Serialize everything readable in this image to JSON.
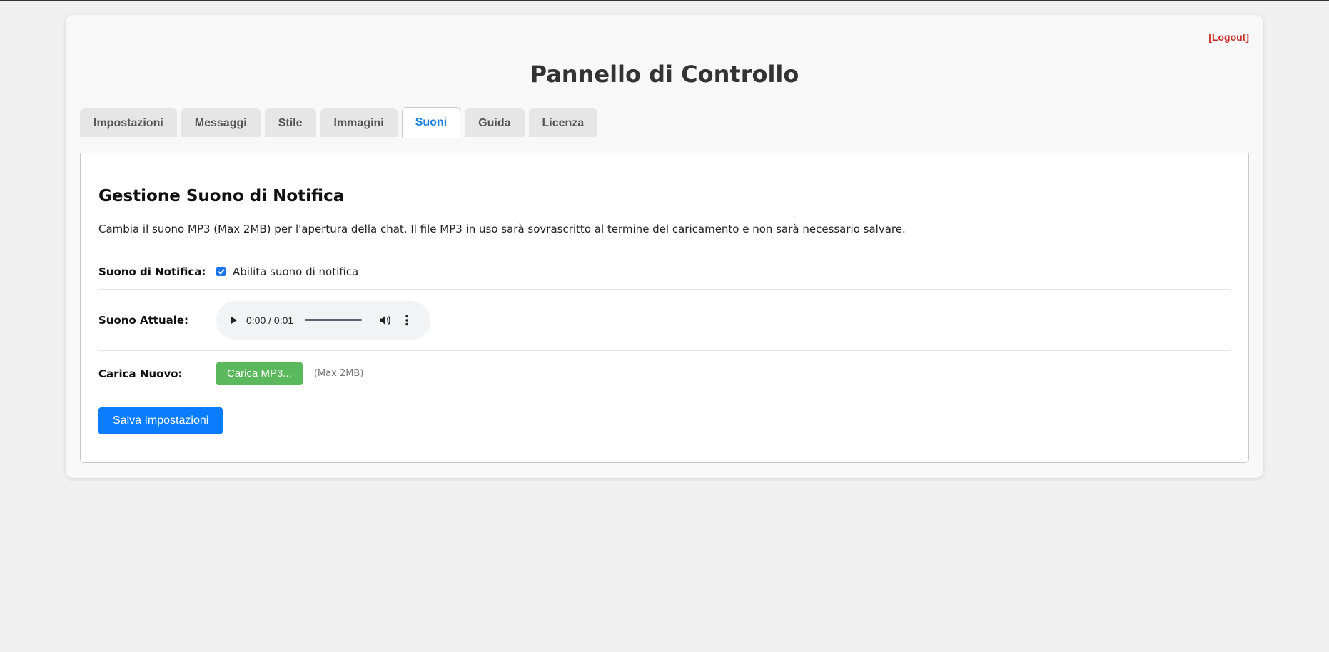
{
  "header": {
    "logout_label": "[Logout]",
    "title": "Pannello di Controllo"
  },
  "tabs": [
    {
      "label": "Impostazioni",
      "active": false
    },
    {
      "label": "Messaggi",
      "active": false
    },
    {
      "label": "Stile",
      "active": false
    },
    {
      "label": "Immagini",
      "active": false
    },
    {
      "label": "Suoni",
      "active": true
    },
    {
      "label": "Guida",
      "active": false
    },
    {
      "label": "Licenza",
      "active": false
    }
  ],
  "sound": {
    "section_title": "Gestione Suono di Notifica",
    "description": "Cambia il suono MP3 (Max 2MB) per l'apertura della chat. Il file MP3 in uso sarà sovrascritto al termine del caricamento e non sarà necessario salvare.",
    "notification": {
      "label": "Suono di Notifica:",
      "checkbox_label": "Abilita suono di notifica",
      "checked": true
    },
    "current": {
      "label": "Suono Attuale:",
      "time_display": "0:00 / 0:01"
    },
    "upload": {
      "label": "Carica Nuovo:",
      "button_label": "Carica MP3...",
      "hint": "(Max 2MB)"
    },
    "save_label": "Salva Impostazioni"
  },
  "icons": {
    "play": "play-icon",
    "volume": "volume-icon",
    "more": "more-vert-icon",
    "check": "check-icon"
  },
  "colors": {
    "accent": "#1a7fe0",
    "logout": "#c9302c",
    "upload_button": "#5cb85c",
    "save_button": "#0a7cff"
  }
}
